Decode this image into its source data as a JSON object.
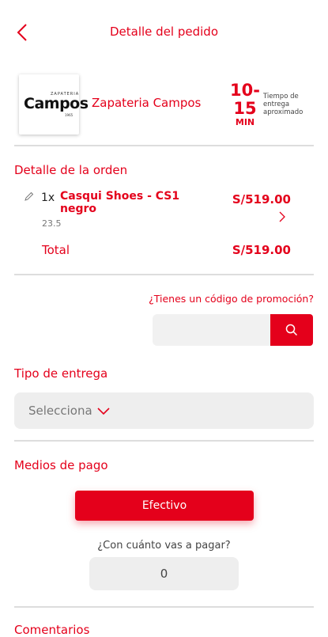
{
  "header": {
    "title": "Detalle del pedido",
    "back_icon": "chevron-left-icon"
  },
  "store": {
    "logo": {
      "small_text": "ZAPATERIA",
      "brand": "Campos",
      "sub_text": "1965"
    },
    "name": "Zapateria Campos",
    "eta": {
      "from": "10-",
      "to": "15",
      "unit": "MIN",
      "label": "Tiempo de entrega aproximado"
    }
  },
  "order": {
    "section_title": "Detalle de la orden",
    "items": [
      {
        "qty": "1x",
        "name": "Casqui Shoes - CS1 negro",
        "variant": "23.5",
        "price": "S/519.00"
      }
    ],
    "total_label": "Total",
    "total_value": "S/519.00"
  },
  "promo": {
    "question": "¿Tienes un código de promoción?",
    "placeholder": "",
    "value": "",
    "button_icon": "search-icon"
  },
  "delivery": {
    "section_title": "Tipo de entrega",
    "select_value": "Selecciona"
  },
  "payment": {
    "section_title": "Medios de pago",
    "method": "Efectivo",
    "amount_question": "¿Con cuánto vas a pagar?",
    "amount_value": "0"
  },
  "comments": {
    "section_title": "Comentarios"
  },
  "colors": {
    "accent": "#e4001b",
    "divider": "#dddddd",
    "field_bg": "#eeeeee"
  }
}
